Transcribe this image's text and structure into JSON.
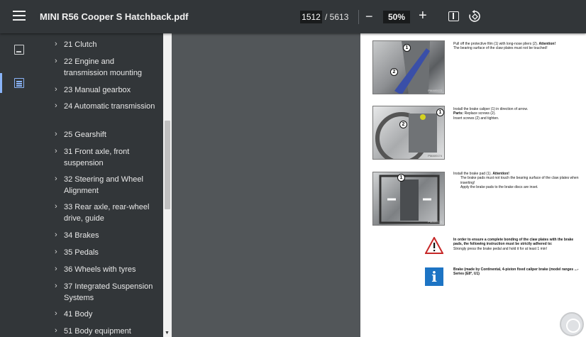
{
  "toolbar": {
    "title": "MINI R56 Cooper S Hatchback.pdf",
    "current_page": "1512",
    "total_pages": "/ 5613",
    "zoom_minus": "−",
    "zoom": "50%",
    "zoom_plus": "+"
  },
  "outline": {
    "items": [
      {
        "label": "21 Clutch"
      },
      {
        "label": "22 Engine and transmission mounting"
      },
      {
        "label": "23 Manual gearbox"
      },
      {
        "label": "24 Automatic transmission"
      },
      {
        "label": "25 Gearshift"
      },
      {
        "label": "31 Front axle, front suspension"
      },
      {
        "label": "32 Steering and Wheel Alignment"
      },
      {
        "label": "33 Rear axle, rear-wheel drive, guide"
      },
      {
        "label": "34 Brakes"
      },
      {
        "label": "35 Pedals"
      },
      {
        "label": "36 Wheels with tyres"
      },
      {
        "label": "37 Integrated Suspension Systems"
      },
      {
        "label": "41 Body"
      },
      {
        "label": "51 Body equipment"
      }
    ]
  },
  "doc": {
    "step1_a": "Pull off the protective film (1) with long-nose pliers (2).",
    "step1_attention": "Attention!",
    "step1_b": "The bearing surface of the claw plates must not be touched!",
    "step2_a": "Install the brake caliper (1) in direction of arrow.",
    "step2_parts": "Parts:",
    "step2_b": "Replace screws (2).",
    "step2_c": "Insert screws (2) and tighten.",
    "step3_a": "Install the brake pad (1).",
    "step3_attention": "Attention!",
    "step3_b": "The brake pads must not touch the bearing surface of the claw plates when inserting!",
    "step3_c": "Apply the brake pads to the brake discs are inset.",
    "warning_a": "In order to ensure a complete bonding of the claw plates with the brake pads, the following instruction must be strictly adhered to:",
    "warning_b": "Strongly press the brake pedal and hold it for at least 1 min!",
    "info_a": "Brake (made by Continental, 4-piston fixed caliper brake (model ranges ...-Series (E8*, U1)",
    "photo1_code": "PMA00172",
    "photo2_code": "PMA00174",
    "photo3_code": "PMA00173",
    "callout_1": "1",
    "callout_2": "2"
  },
  "colors": {
    "toolbar_bg": "#323639",
    "viewer_bg": "#525659",
    "accent": "#8ab4f8",
    "info_blue": "#1d74c4",
    "warning_red": "#c62828"
  },
  "icons": [
    "menu-icon",
    "rotate-icon",
    "fit-page-icon",
    "thumbnails-icon",
    "outline-icon",
    "chevron-right-icon",
    "warning-icon",
    "info-icon"
  ]
}
